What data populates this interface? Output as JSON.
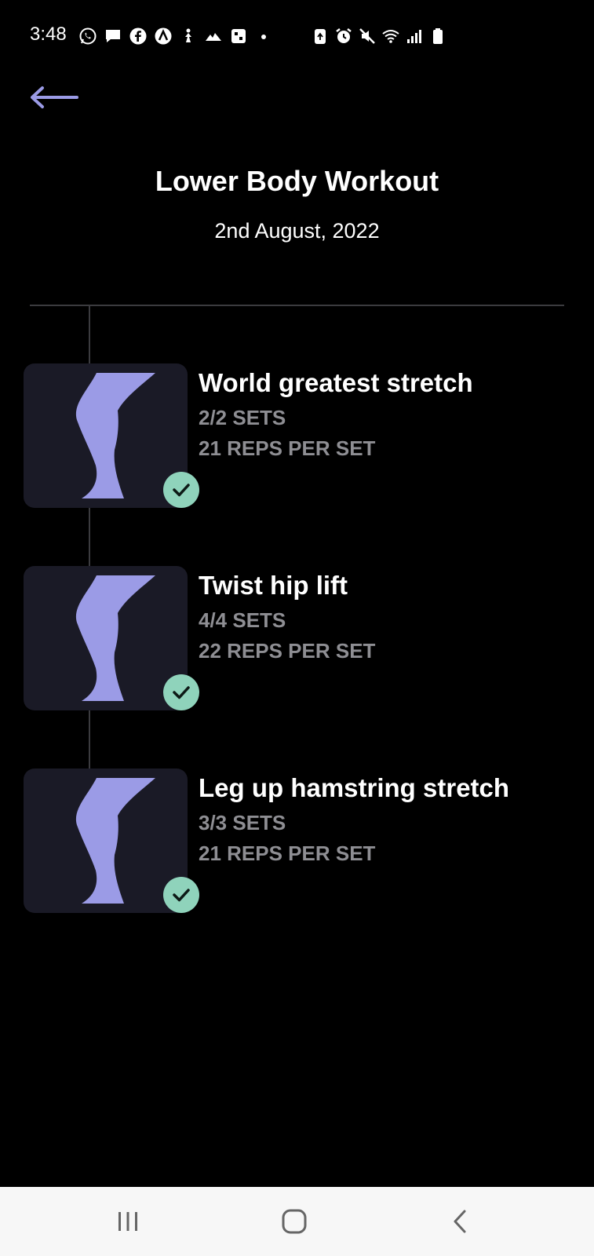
{
  "status_bar": {
    "time": "3:48",
    "left_icons": [
      "whatsapp-icon",
      "message-icon",
      "facebook-icon",
      "app-icon",
      "fitness-icon",
      "signal-app-icon",
      "photo-app-icon",
      "dot-icon"
    ],
    "right_icons": [
      "battery-saver-icon",
      "alarm-icon",
      "mute-icon",
      "wifi-icon",
      "cellular-signal-icon",
      "battery-icon"
    ]
  },
  "header": {
    "back_icon": "arrow-left-icon",
    "title": "Lower Body Workout",
    "date": "2nd August, 2022"
  },
  "exercises": [
    {
      "name": "World greatest stretch",
      "sets": "2/2 SETS",
      "reps": "21 REPS PER SET",
      "completed": true
    },
    {
      "name": "Twist hip lift",
      "sets": "4/4 SETS",
      "reps": "22 REPS PER SET",
      "completed": true
    },
    {
      "name": "Leg up hamstring stretch",
      "sets": "3/3 SETS",
      "reps": "21 REPS PER SET",
      "completed": true
    }
  ],
  "nav_bar": {
    "icons": [
      "recent-apps-icon",
      "home-icon",
      "back-icon"
    ]
  },
  "colors": {
    "background": "#000000",
    "accent": "#9b9be6",
    "check": "#8fd3bb",
    "thumb_bg": "#1a1a26",
    "secondary_text": "#8e8e93",
    "nav_bar": "#f7f7f7"
  }
}
